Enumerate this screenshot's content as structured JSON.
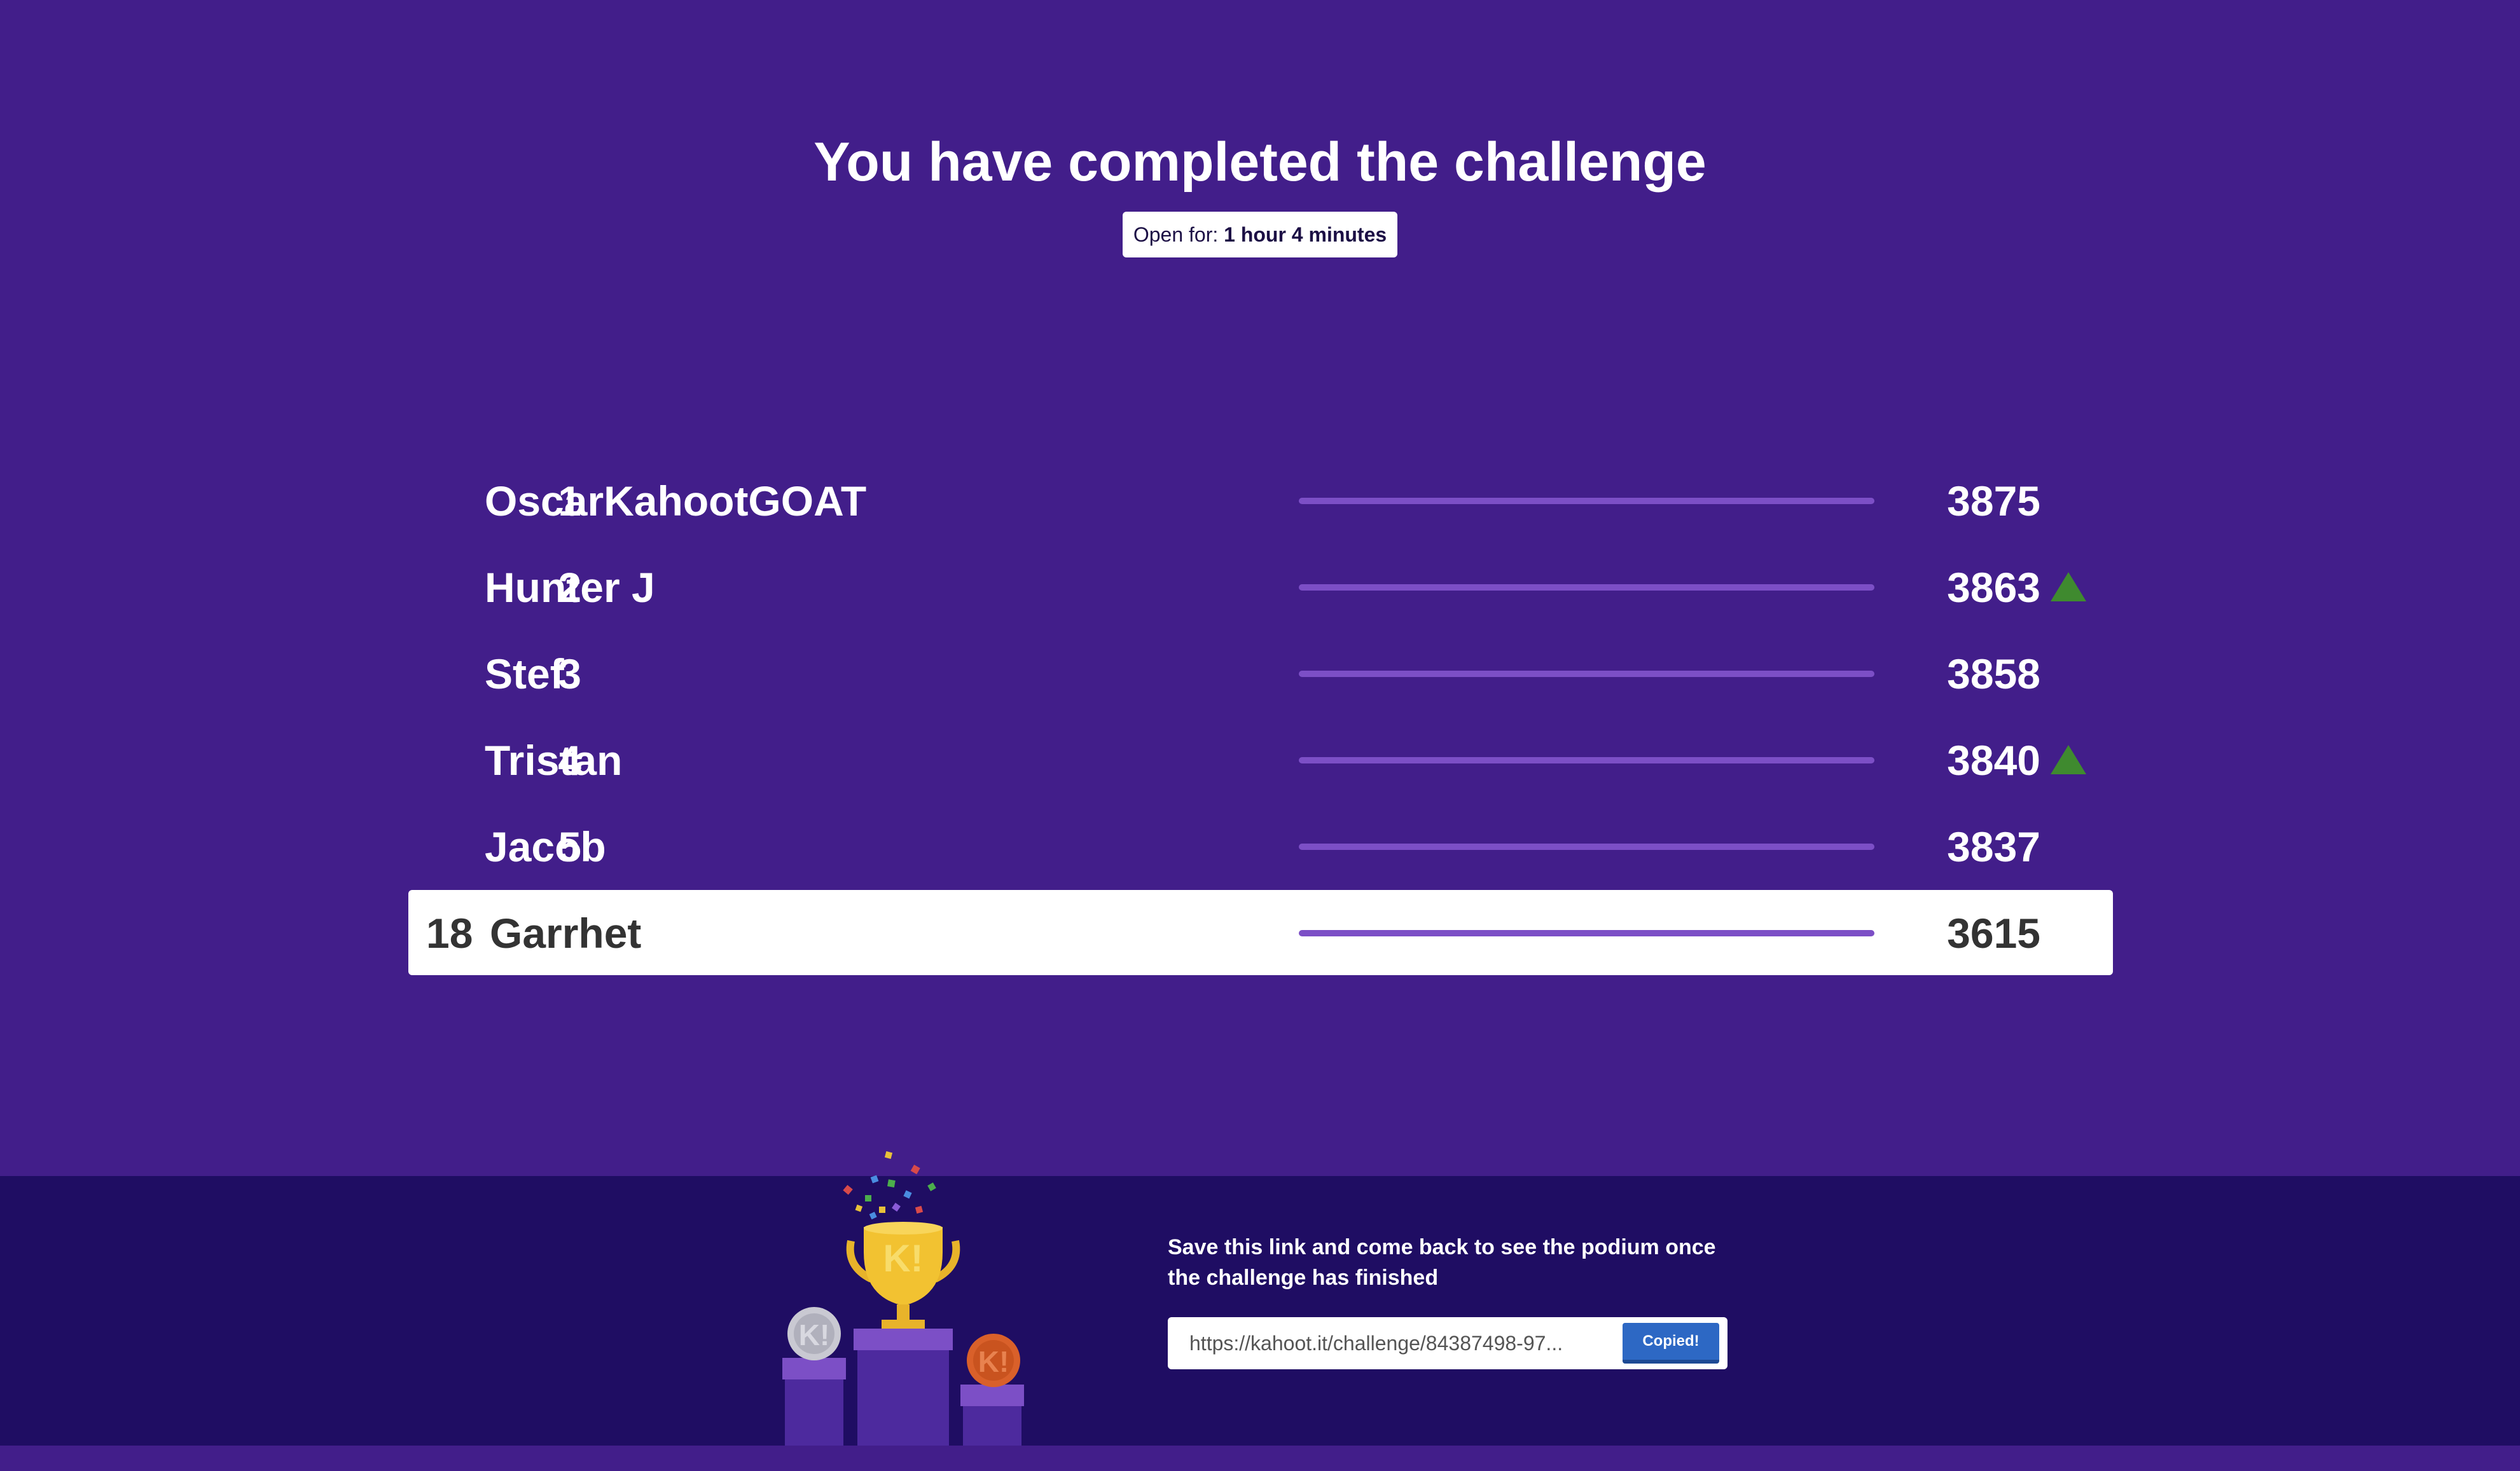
{
  "header": {
    "title": "You have completed the challenge",
    "open_for_label": "Open for:",
    "open_for_value": "1 hour 4 minutes"
  },
  "leaderboard": [
    {
      "rank": "1",
      "name": "OscarKahootGOAT",
      "score": "3875",
      "trend": "none"
    },
    {
      "rank": "2",
      "name": "Hunter J",
      "score": "3863",
      "trend": "up"
    },
    {
      "rank": "3",
      "name": "Stef",
      "score": "3858",
      "trend": "none"
    },
    {
      "rank": "4",
      "name": "Tristan",
      "score": "3840",
      "trend": "up"
    },
    {
      "rank": "5",
      "name": "Jacob",
      "score": "3837",
      "trend": "none"
    }
  ],
  "current_player": {
    "rank": "18",
    "name": "Garrhet",
    "score": "3615"
  },
  "footer": {
    "save_text": "Save this link and come back to see the podium once the challenge has finished",
    "link_value": "https://kahoot.it/challenge/84387498-97...",
    "copied_label": "Copied!"
  },
  "colors": {
    "background": "#421e8a",
    "footer_background": "#1f0d63",
    "bar": "#7c4fc6",
    "trend_up": "#3f8a2f",
    "button": "#2d68c4"
  },
  "icons": {
    "trend_up": "triangle-up-icon",
    "podium": "trophy-podium-illustration"
  }
}
